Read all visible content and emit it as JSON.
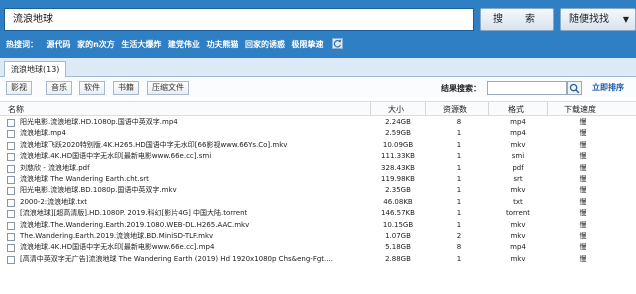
{
  "search": {
    "query": "流浪地球",
    "button_label": "搜　索",
    "random_label": "随便找找",
    "random_caret": "▼"
  },
  "hot": {
    "label": "热搜词：",
    "keywords": [
      "源代码",
      "家的n次方",
      "生活大爆炸",
      "建党伟业",
      "功夫熊猫",
      "回家的诱惑",
      "极限挚速"
    ]
  },
  "tab": {
    "label": "流浪地球(13)"
  },
  "filters": [
    "影视",
    "音乐",
    "软件",
    "书籍",
    "压缩文件"
  ],
  "result_search": {
    "label": "结果搜索：",
    "value": ""
  },
  "sort_link": "立即排序",
  "table": {
    "headers": {
      "name": "名称",
      "size": "大小",
      "count": "资源数",
      "format": "格式",
      "speed": "下载速度"
    },
    "rows": [
      {
        "name": "阳光电影.流浪地球.HD.1080p.国语中英双字.mp4",
        "size": "2.24GB",
        "count": "8",
        "format": "mp4",
        "speed": "慢"
      },
      {
        "name": "流浪地球.mp4",
        "size": "2.59GB",
        "count": "1",
        "format": "mp4",
        "speed": "慢"
      },
      {
        "name": "流浪地球飞跃2020特别版.4K.H265.HD国语中字无水印[66影视www.66Ys.Co].mkv",
        "size": "10.09GB",
        "count": "1",
        "format": "mkv",
        "speed": "慢"
      },
      {
        "name": "流浪地球.4K.HD国语中字无水印[最新电影www.66e.cc].smi",
        "size": "111.33KB",
        "count": "1",
        "format": "smi",
        "speed": "慢"
      },
      {
        "name": "刘慈欣 - 流浪地球.pdf",
        "size": "328.43KB",
        "count": "1",
        "format": "pdf",
        "speed": "慢"
      },
      {
        "name": "流浪地球 The Wandering Earth.cht.srt",
        "size": "119.98KB",
        "count": "1",
        "format": "srt",
        "speed": "慢"
      },
      {
        "name": "阳光电影.流浪地球.BD.1080p.国语中英双字.mkv",
        "size": "2.35GB",
        "count": "1",
        "format": "mkv",
        "speed": "慢"
      },
      {
        "name": "2000-2:流浪地球.txt",
        "size": "46.08KB",
        "count": "1",
        "format": "txt",
        "speed": "慢"
      },
      {
        "name": "[流浪地球][超高清版].HD.1080P. 2019.科幻[影片4G] 中国大陆.torrent",
        "size": "146.57KB",
        "count": "1",
        "format": "torrent",
        "speed": "慢"
      },
      {
        "name": "流浪地球.The.Wandering.Earth.2019.1080.WEB-DL.H265.AAC.mkv",
        "size": "10.15GB",
        "count": "1",
        "format": "mkv",
        "speed": "慢"
      },
      {
        "name": "The.Wandering.Earth.2019.流浪地球.BD.MiniSD-TLF.mkv",
        "size": "1.07GB",
        "count": "2",
        "format": "mkv",
        "speed": "慢"
      },
      {
        "name": "流浪地球.4K.HD国语中字无水印[最新电影www.66e.cc].mp4",
        "size": "5.18GB",
        "count": "8",
        "format": "mp4",
        "speed": "慢"
      },
      {
        "name": "[高清中英双字无广告]流浪地球 The Wandering Earth (2019) Hd 1920x1080p Chs&eng-Fgt....",
        "size": "2.88GB",
        "count": "1",
        "format": "mkv",
        "speed": "慢"
      }
    ]
  },
  "colors": {
    "header_blue": "#2f7fc4",
    "tab_strip": "#dde9f5",
    "link_blue": "#1a5ca8"
  },
  "icons": {
    "refresh": "refresh-icon",
    "search": "magnifier-icon"
  }
}
